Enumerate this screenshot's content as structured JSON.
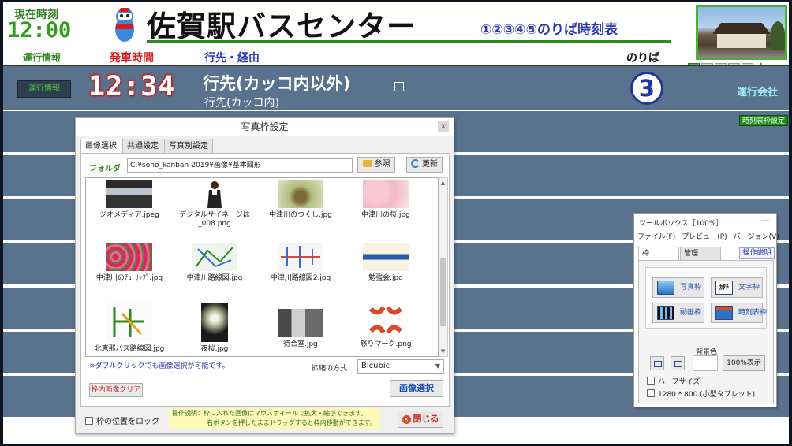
{
  "board": {
    "clock_label": "現在時刻",
    "clock_time": "12:00",
    "station_title": "佐賀駅バスセンター",
    "platforms_title": "①②③④⑤のりば時刻表",
    "header_labels": {
      "info": "運行情報",
      "departure": "発車時間",
      "destination": "行先・経由",
      "platform": "のりば"
    },
    "pages": [
      "1",
      "2",
      "3",
      "4",
      "5"
    ],
    "active_page": "1",
    "row1": {
      "info_button": "運行情報",
      "departure_time": "12:34",
      "destination_main": "行先(カッコ内以外)",
      "destination_sub": "行先(カッコ内)",
      "platform_number": "3",
      "operator": "運行会社"
    },
    "schedule_settings_button": "時刻表枠設定",
    "accent_green": "#2e8a20",
    "accent_red": "#d81b1b",
    "row_color": "#59728d"
  },
  "photo_dialog": {
    "title": "写真枠設定",
    "close_glyph": "x",
    "tabs": [
      "画像選択",
      "共通設定",
      "写真別設定"
    ],
    "folder_label": "フォルダ",
    "folder_path": "C:¥sono_kanban-2019¥画像¥基本図形",
    "browse_button": "参照",
    "refresh_button": "更新",
    "thumbnails": [
      {
        "caption": "ジオメディア.jpeg"
      },
      {
        "caption": "デジタルサイネージは_008.png"
      },
      {
        "caption": "中津川のつくし.jpg"
      },
      {
        "caption": "中津川の桜.jpg"
      },
      {
        "caption": "中津川のﾁｭｰﾘｯﾌﾟ.jpg"
      },
      {
        "caption": "中津川路線図.jpg"
      },
      {
        "caption": "中津川路線図2.jpg"
      },
      {
        "caption": "勉強会.jpg"
      },
      {
        "caption": "北恵那バス路線図.jpg"
      },
      {
        "caption": "夜桜.jpg"
      },
      {
        "caption": "待合室.jpg"
      },
      {
        "caption": "怒りマーク.png"
      }
    ],
    "hint": "※ダブルクリックでも画像選択が可能です。",
    "scale_label": "拡縮の方式",
    "scale_value": "Bicubic",
    "clear_button": "枠内画像クリア",
    "select_button": "画像選択",
    "lock_label": "枠の位置をロック",
    "note_line1": "操作説明：枠に入れた画像はマウスホイールで拡大・縮小できます。",
    "note_line2": "右ボタンを押したままドラッグすると枠内移動ができます。",
    "close_button": "閉じる"
  },
  "toolbox": {
    "title": "ツールボックス［100%］",
    "minimize_glyph": "—",
    "menus": [
      "ファイル(F)",
      "プレビュー(P)",
      "バージョン(V)"
    ],
    "tabs": [
      "枠",
      "管理"
    ],
    "help_button": "操作説明",
    "tools": {
      "photo": "写真枠",
      "text": "文字枠",
      "video": "動画枠",
      "schedule": "時刻表枠"
    },
    "text_icon_glyph": "ｶﾀﾁ",
    "bg_color_label": "背景色",
    "pct_button": "100%表示",
    "check_half": "ハーフサイズ",
    "check_tablet": "1280 * 800 (小型タブレット)"
  }
}
